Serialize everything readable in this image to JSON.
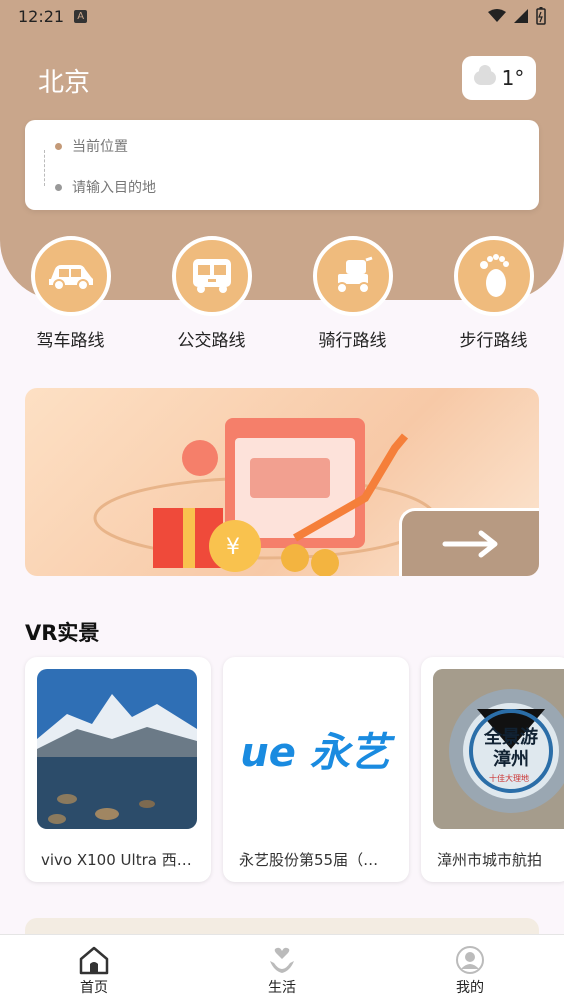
{
  "status": {
    "time": "12:21",
    "a_icon": "A"
  },
  "header": {
    "city": "北京",
    "weather": {
      "temp": "1°",
      "icon": "cloud-icon"
    }
  },
  "route": {
    "from_placeholder": "当前位置",
    "to_placeholder": "请输入目的地",
    "from_dot_color": "#c49a78",
    "to_dot_color": "#999999"
  },
  "modes": [
    {
      "label": "驾车路线",
      "icon": "car-icon"
    },
    {
      "label": "公交路线",
      "icon": "bus-icon"
    },
    {
      "label": "骑行路线",
      "icon": "scooter-icon"
    },
    {
      "label": "步行路线",
      "icon": "footprint-icon"
    }
  ],
  "section": {
    "vr_title": "VR实景"
  },
  "vr_cards": [
    {
      "caption": "vivo X100 Ultra 西…"
    },
    {
      "caption": "永艺股份第55届（…",
      "logo_text": "ue 永艺"
    },
    {
      "caption": "漳州市城市航拍",
      "overlay_text": "全景游漳州",
      "sub_text": "十佳大理地"
    }
  ],
  "nav": [
    {
      "label": "首页",
      "icon": "home-icon"
    },
    {
      "label": "生活",
      "icon": "heart-hand-icon"
    },
    {
      "label": "我的",
      "icon": "user-icon"
    }
  ],
  "colors": {
    "header": "#c9a68b",
    "accent": "#efbb7d",
    "nav_text": "#222222"
  }
}
